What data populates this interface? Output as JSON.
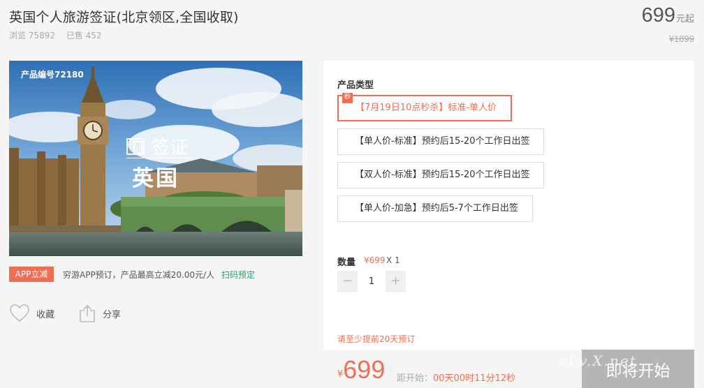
{
  "product": {
    "title": "英国个人旅游签证(北京领区,全国收取)",
    "views_text": "浏览 75892",
    "sold_text": "已售 452",
    "price": "699",
    "price_unit": "元起",
    "original_price": "¥1899",
    "code_text": "产品编号72180"
  },
  "hero": {
    "visa_label": "签证",
    "country": "英国"
  },
  "promo": {
    "badge": "APP立减",
    "text": "穷游APP预订，产品最高立减20.00元/人",
    "link": "扫码预定"
  },
  "actions": {
    "collect": "收藏",
    "share": "分享"
  },
  "order": {
    "type_label": "产品类型",
    "flag_text": "秒",
    "options": [
      {
        "label": "【7月19日10点秒杀】标准-单人价",
        "selected": true
      },
      {
        "label": "【单人价-标准】预约后15-20个工作日出签",
        "selected": false
      },
      {
        "label": "【双人价-标准】预约后15-20个工作日出签",
        "selected": false
      },
      {
        "label": "【单人价-加急】预约后5-7个工作日出签",
        "selected": false
      }
    ],
    "qty_label": "数量",
    "qty_price": "¥699",
    "qty_times": "X 1",
    "qty_minus": "−",
    "qty_value": "1",
    "qty_plus": "+",
    "notice": "请至少提前20天预订",
    "total_yen": "¥",
    "total_price": "699",
    "countdown_label": "距开始：",
    "countdown_time": "00天00时11分12秒",
    "buy_label": "即将开始"
  },
  "watermark": "eLv.X.net",
  "colors": {
    "accent": "#f06e52",
    "link_green": "#23a26a",
    "disabled_button": "#b5b5b5"
  }
}
